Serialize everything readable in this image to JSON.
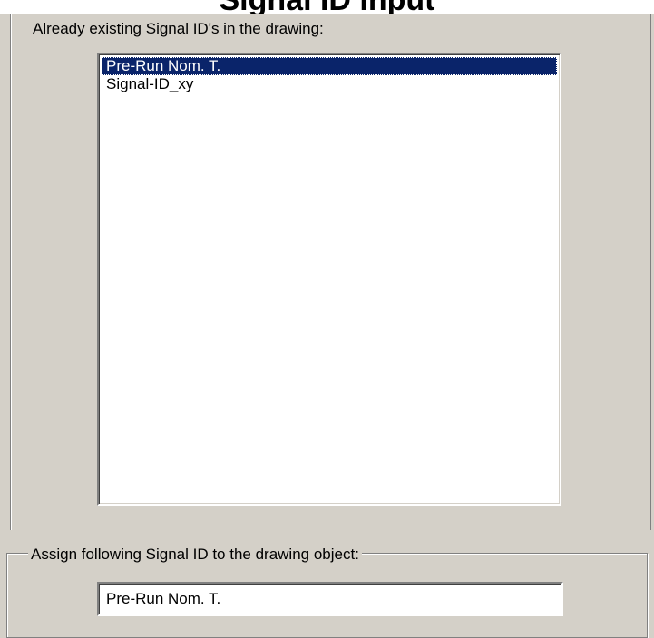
{
  "window": {
    "title": "Signal ID input"
  },
  "signal_list": {
    "label": "Already existing Signal ID's in the drawing:",
    "items": [
      {
        "label": "Pre-Run Nom. T.",
        "selected": true
      },
      {
        "label": "Signal-ID_xy",
        "selected": false
      }
    ]
  },
  "assign": {
    "label": "Assign following Signal ID to the drawing object:",
    "value": "Pre-Run Nom. T."
  },
  "colors": {
    "dialog_bg": "#d4d0c8",
    "selection_bg": "#0a246a",
    "selection_text": "#ffffff"
  }
}
